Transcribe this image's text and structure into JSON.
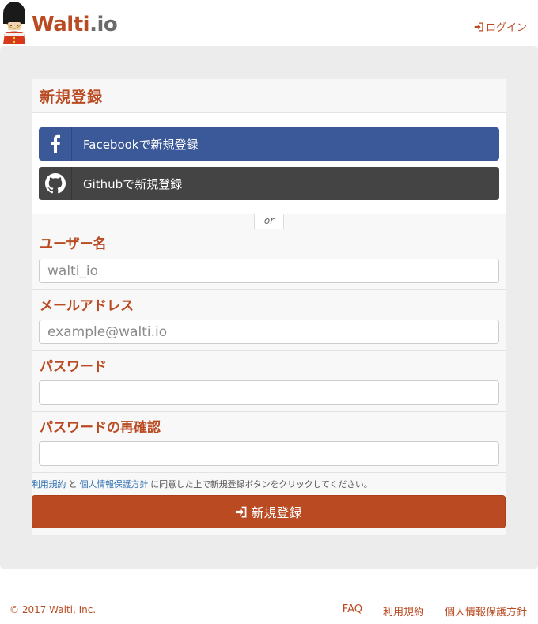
{
  "brand": {
    "name_main": "Walti",
    "name_tld": ".io",
    "primary_color": "#b94a21"
  },
  "header": {
    "login_label": "ログイン"
  },
  "panel": {
    "title": "新規登録"
  },
  "social": {
    "facebook_label": "Facebookで新規登録",
    "github_label": "Githubで新規登録",
    "facebook_color": "#3b5998",
    "github_color": "#444444"
  },
  "separator": {
    "text": "or"
  },
  "form": {
    "username_label": "ユーザー名",
    "username_placeholder": "walti_io",
    "email_label": "メールアドレス",
    "email_placeholder": "example@walti.io",
    "password_label": "パスワード",
    "password_confirm_label": "パスワードの再確認"
  },
  "notice": {
    "terms_link": "利用規約",
    "and": " と ",
    "privacy_link": "個人情報保護方針",
    "rest": " に同意した上で新規登録ボタンをクリックしてください。"
  },
  "submit": {
    "label": "新規登録"
  },
  "footer": {
    "copyright": "© 2017 Walti, Inc.",
    "links": [
      "FAQ",
      "利用規約",
      "個人情報保護方針"
    ]
  },
  "icons": {
    "login": "sign-in-icon",
    "facebook": "facebook-icon",
    "github": "github-icon",
    "submit": "sign-in-icon"
  }
}
